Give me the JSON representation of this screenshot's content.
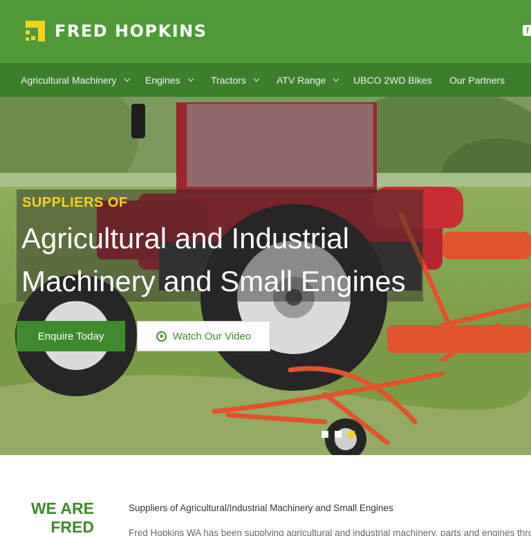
{
  "brand": {
    "name": "FRED HOPKINS",
    "colors": {
      "primary": "#4f9a37",
      "nav": "#3c7f2b",
      "accent": "#f6d21f"
    }
  },
  "header": {
    "social_icon": "facebook-icon",
    "social_glyph": "f"
  },
  "nav": {
    "items": [
      {
        "label": "Agricultural Machinery",
        "has_dropdown": true
      },
      {
        "label": "Engines",
        "has_dropdown": true
      },
      {
        "label": "Tractors",
        "has_dropdown": true
      },
      {
        "label": "ATV Range",
        "has_dropdown": true
      },
      {
        "label": "UBCO 2WD Bikes",
        "has_dropdown": false
      },
      {
        "label": "Our Partners",
        "has_dropdown": false
      }
    ]
  },
  "hero": {
    "kicker": "SUPPLIERS OF",
    "headline_line1": "Agricultural and Industrial",
    "headline_line2": "Machinery and Small Engines",
    "primary_button": "Enquire Today",
    "video_button": "Watch Our Video",
    "slides_total": 3,
    "active_slide": 3
  },
  "about": {
    "heading_line1": "WE ARE",
    "heading_line2": "FRED",
    "subtitle": "Suppliers of Agricultural/Industrial Machinery and Small Engines",
    "body": "Fred Hopkins WA has been supplying agricultural and industrial machinery, parts and engines throu"
  }
}
